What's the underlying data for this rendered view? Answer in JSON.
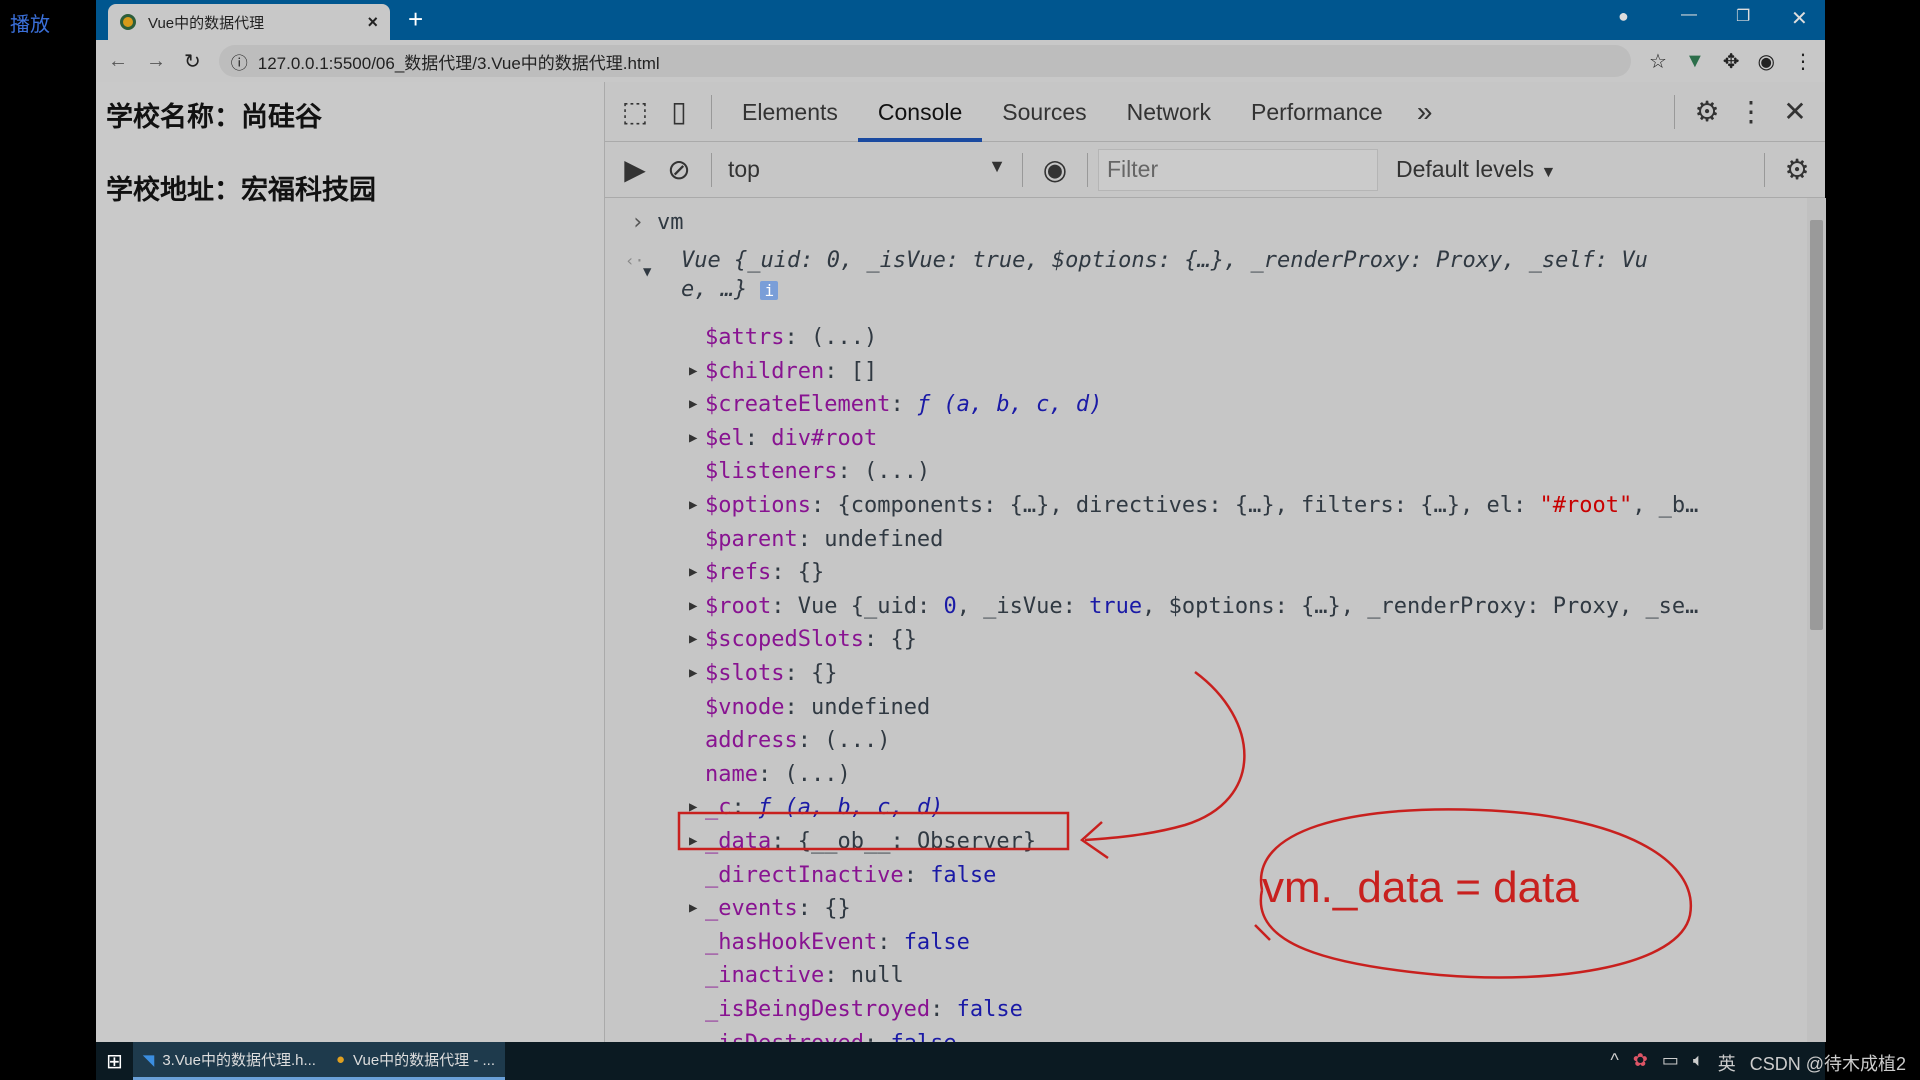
{
  "player_label": "播放",
  "browser": {
    "tab_title": "Vue中的数据代理",
    "url": "127.0.0.1:5500/06_数据代理/3.Vue中的数据代理.html"
  },
  "page": {
    "lines": [
      "学校名称：尚硅谷",
      "学校地址：宏福科技园"
    ]
  },
  "devtools": {
    "tabs": [
      "Elements",
      "Console",
      "Sources",
      "Network",
      "Performance"
    ],
    "active_tab": "Console",
    "context": "top",
    "filter_placeholder": "Filter",
    "levels": "Default levels",
    "input": "vm",
    "summary_line1": "Vue {_uid: 0, _isVue: true, $options: {…}, _renderProxy: Proxy, _self: Vu",
    "summary_line2": "e, …}",
    "rows": [
      {
        "arrow": false,
        "key": "$attrs",
        "val": [
          [
            "(...)",
            "p"
          ]
        ]
      },
      {
        "arrow": true,
        "key": "$children",
        "val": [
          [
            "[]",
            "p"
          ]
        ]
      },
      {
        "arrow": true,
        "key": "$createElement",
        "val": [
          [
            "ƒ (a, b, c, d)",
            "f"
          ]
        ]
      },
      {
        "arrow": true,
        "key": "$el",
        "val": [
          [
            "div#root",
            "k"
          ]
        ]
      },
      {
        "arrow": false,
        "key": "$listeners",
        "val": [
          [
            "(...)",
            "p"
          ]
        ]
      },
      {
        "arrow": true,
        "key": "$options",
        "val": [
          [
            "{components: {…}, directives: {…}, filters: {…}, el: ",
            "p"
          ],
          [
            "\"#root\"",
            "s"
          ],
          [
            ", _b…",
            "p"
          ]
        ]
      },
      {
        "arrow": false,
        "key": "$parent",
        "val": [
          [
            "undefined",
            "p"
          ]
        ]
      },
      {
        "arrow": true,
        "key": "$refs",
        "val": [
          [
            "{}",
            "p"
          ]
        ]
      },
      {
        "arrow": true,
        "key": "$root",
        "val": [
          [
            "Vue {_uid: ",
            "p"
          ],
          [
            "0",
            "n"
          ],
          [
            ", _isVue: ",
            "p"
          ],
          [
            "true",
            "n"
          ],
          [
            ", $options: {…}, _renderProxy: Proxy, _se…",
            "p"
          ]
        ]
      },
      {
        "arrow": true,
        "key": "$scopedSlots",
        "val": [
          [
            "{}",
            "p"
          ]
        ]
      },
      {
        "arrow": true,
        "key": "$slots",
        "val": [
          [
            "{}",
            "p"
          ]
        ]
      },
      {
        "arrow": false,
        "key": "$vnode",
        "val": [
          [
            "undefined",
            "p"
          ]
        ]
      },
      {
        "arrow": false,
        "key": "address",
        "val": [
          [
            "(...)",
            "p"
          ]
        ]
      },
      {
        "arrow": false,
        "key": "name",
        "val": [
          [
            "(...)",
            "p"
          ]
        ]
      },
      {
        "arrow": true,
        "key": "_c",
        "val": [
          [
            "ƒ (a, b, c, d)",
            "f"
          ]
        ]
      },
      {
        "arrow": true,
        "key": "_data",
        "val": [
          [
            "{__ob__: Observer}",
            "p"
          ]
        ]
      },
      {
        "arrow": false,
        "key": "_directInactive",
        "val": [
          [
            "false",
            "n"
          ]
        ]
      },
      {
        "arrow": true,
        "key": "_events",
        "val": [
          [
            "{}",
            "p"
          ]
        ]
      },
      {
        "arrow": false,
        "key": "_hasHookEvent",
        "val": [
          [
            "false",
            "n"
          ]
        ]
      },
      {
        "arrow": false,
        "key": "_inactive",
        "val": [
          [
            "null",
            "p"
          ]
        ]
      },
      {
        "arrow": false,
        "key": "_isBeingDestroyed",
        "val": [
          [
            "false",
            "n"
          ]
        ]
      },
      {
        "arrow": false,
        "key": "_isDestroyed",
        "val": [
          [
            "false",
            "n"
          ]
        ]
      }
    ]
  },
  "annotation": {
    "text": "vm._data = data",
    "color": "#c8201e"
  },
  "taskbar": {
    "items": [
      "3.Vue中的数据代理.h...",
      "Vue中的数据代理 - ..."
    ],
    "tray": "英",
    "watermark": "CSDN @待木成植2"
  }
}
